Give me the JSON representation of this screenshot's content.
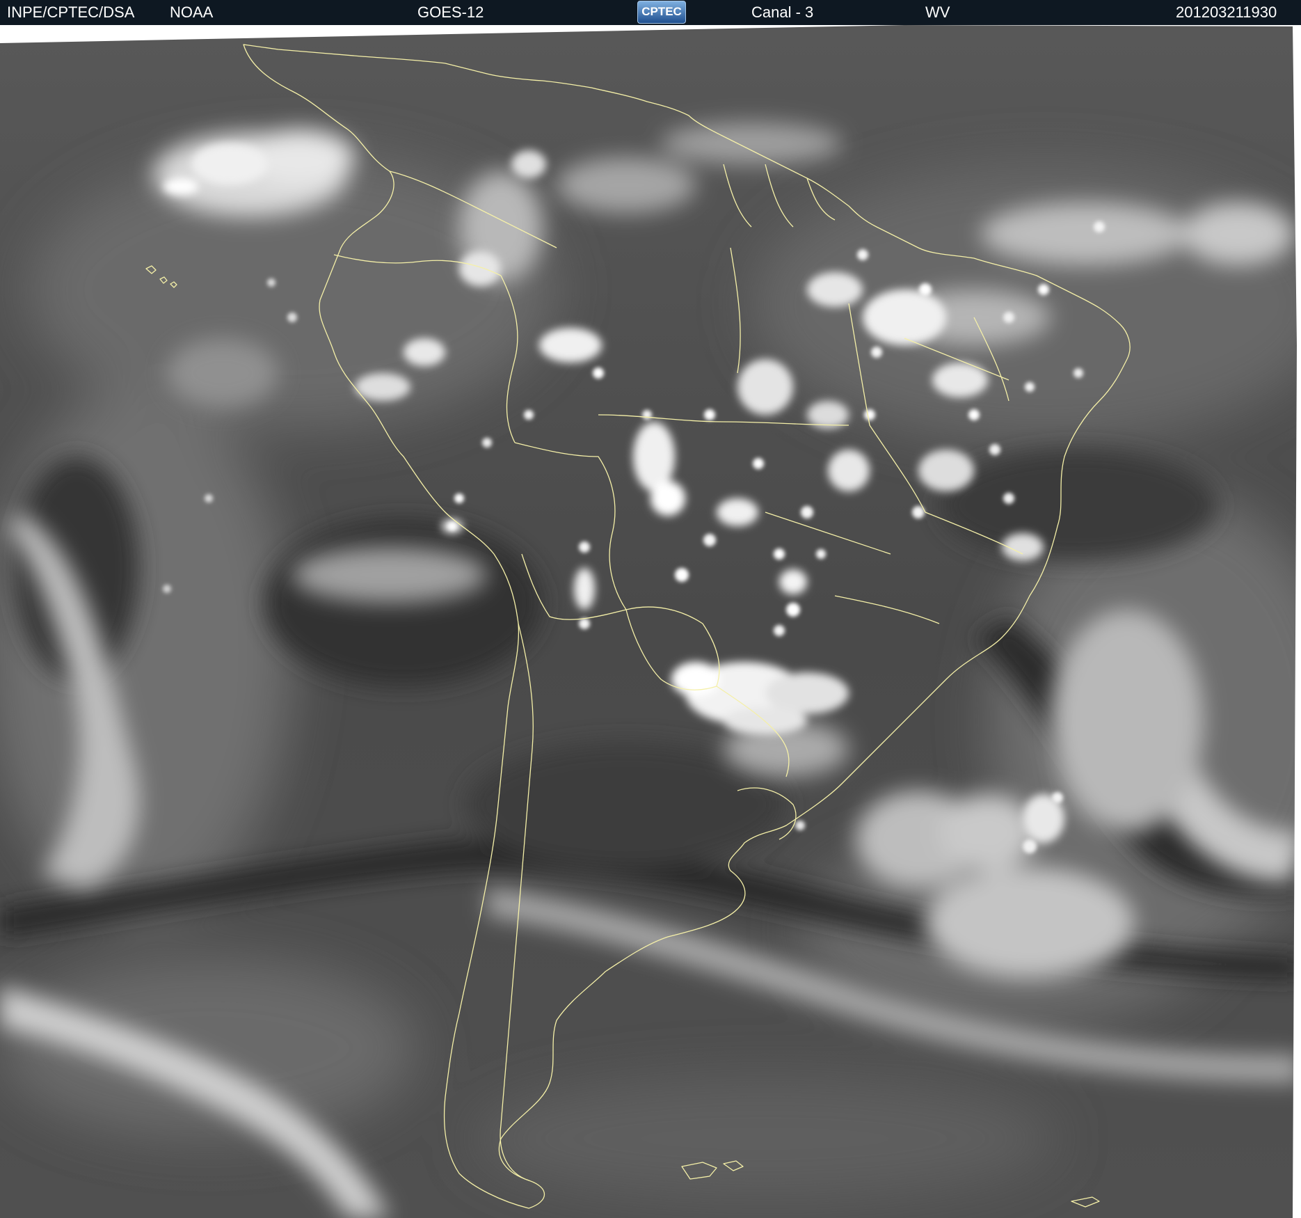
{
  "header": {
    "source": "INPE/CPTEC/DSA",
    "agency": "NOAA",
    "satellite": "GOES-12",
    "logo_text": "CPTEC",
    "channel": "Canal - 3",
    "band": "WV",
    "timestamp": "201203211930"
  },
  "colors": {
    "header_bg": "#0e1822",
    "header_text": "#ffffff",
    "map_border": "#f5f0a8",
    "ocean_gray": "#4a4a4a",
    "cloud_white": "#f2f2f2",
    "dry_band": "#1f1f1f"
  },
  "image": {
    "subject": "water-vapor satellite image of South America",
    "overlay": "country and state borders"
  }
}
